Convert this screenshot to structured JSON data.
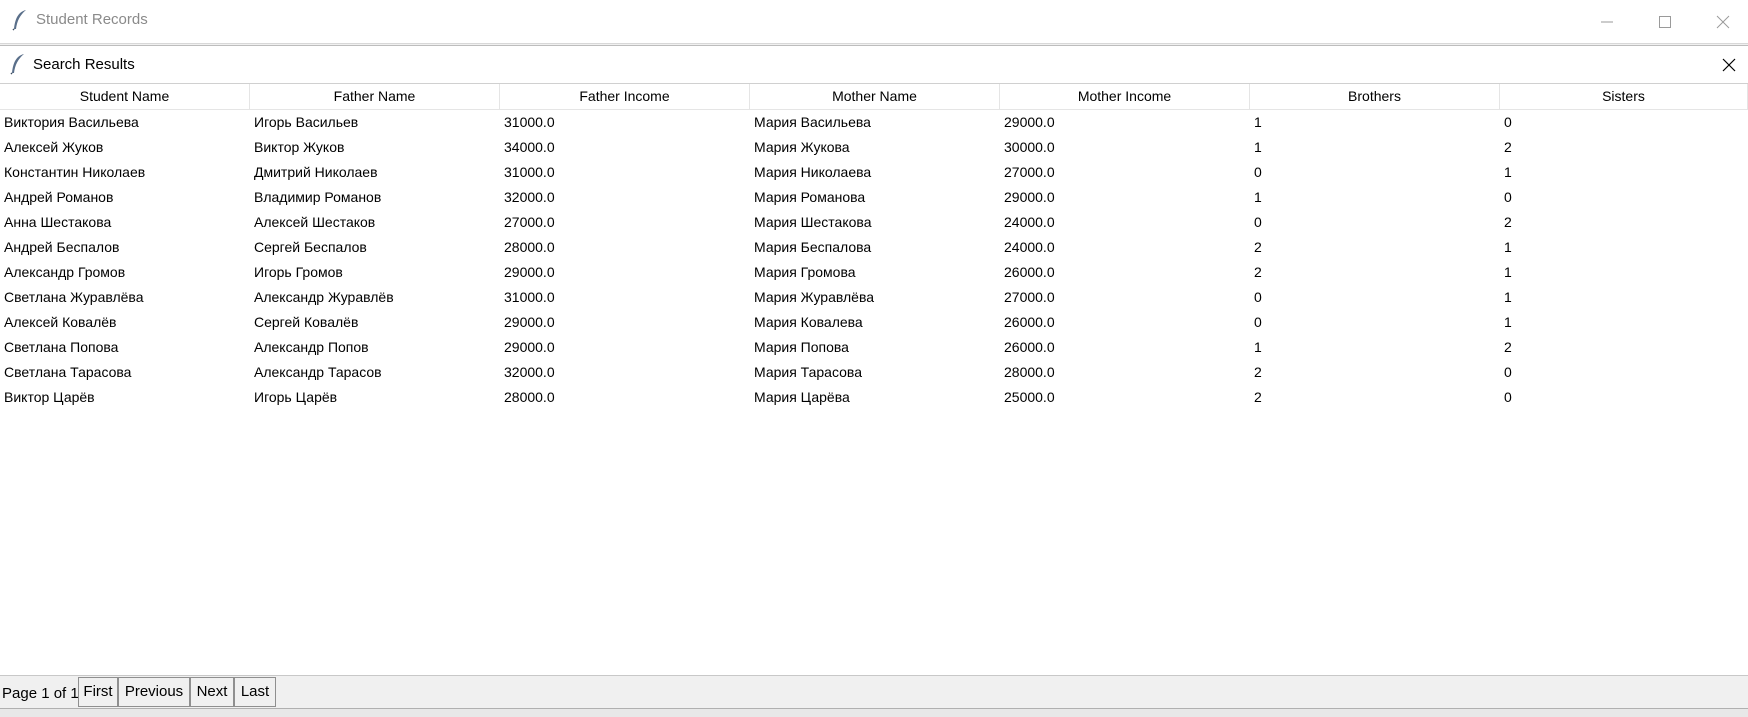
{
  "main_window": {
    "title": "Student Records",
    "icon": "feather-icon",
    "controls": [
      "minimize-icon",
      "maximize-icon",
      "close-icon"
    ]
  },
  "dialog": {
    "title": "Search Results",
    "icon": "feather-icon"
  },
  "table": {
    "columns": [
      "Student Name",
      "Father Name",
      "Father Income",
      "Mother Name",
      "Mother Income",
      "Brothers",
      "Sisters"
    ],
    "rows": [
      [
        "Виктория Васильева",
        "Игорь Васильев",
        "31000.0",
        "Мария Васильева",
        "29000.0",
        "1",
        "0"
      ],
      [
        "Алексей Жуков",
        "Виктор Жуков",
        "34000.0",
        "Мария Жукова",
        "30000.0",
        "1",
        "2"
      ],
      [
        "Константин Николаев",
        "Дмитрий Николаев",
        "31000.0",
        "Мария Николаева",
        "27000.0",
        "0",
        "1"
      ],
      [
        "Андрей Романов",
        "Владимир Романов",
        "32000.0",
        "Мария Романова",
        "29000.0",
        "1",
        "0"
      ],
      [
        "Анна Шестакова",
        "Алексей Шестаков",
        "27000.0",
        "Мария Шестакова",
        "24000.0",
        "0",
        "2"
      ],
      [
        "Андрей Беспалов",
        "Сергей Беспалов",
        "28000.0",
        "Мария Беспалова",
        "24000.0",
        "2",
        "1"
      ],
      [
        "Александр Громов",
        "Игорь Громов",
        "29000.0",
        "Мария Громова",
        "26000.0",
        "2",
        "1"
      ],
      [
        "Светлана Журавлёва",
        "Александр Журавлёв",
        "31000.0",
        "Мария Журавлёва",
        "27000.0",
        "0",
        "1"
      ],
      [
        "Алексей Ковалёв",
        "Сергей Ковалёв",
        "29000.0",
        "Мария Ковалева",
        "26000.0",
        "0",
        "1"
      ],
      [
        "Светлана Попова",
        "Александр Попов",
        "29000.0",
        "Мария Попова",
        "26000.0",
        "1",
        "2"
      ],
      [
        "Светлана Тарасова",
        "Александр Тарасов",
        "32000.0",
        "Мария Тарасова",
        "28000.0",
        "2",
        "0"
      ],
      [
        "Виктор Царёв",
        "Игорь Царёв",
        "28000.0",
        "Мария Царёва",
        "25000.0",
        "2",
        "0"
      ]
    ]
  },
  "pager": {
    "page_info": "Page 1 of 1",
    "first_label": "First",
    "previous_label": "Previous",
    "next_label": "Next",
    "last_label": "Last"
  }
}
